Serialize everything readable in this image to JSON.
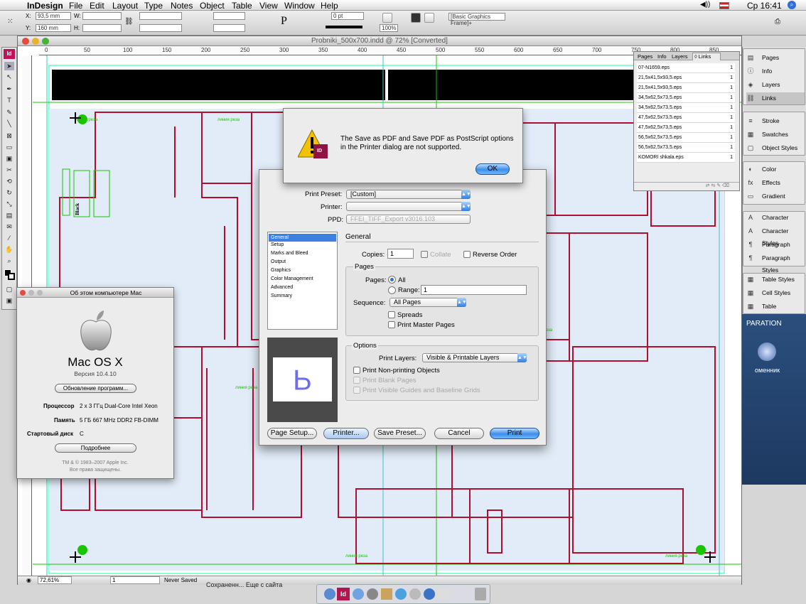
{
  "menubar": {
    "app": "InDesign",
    "items": [
      "File",
      "Edit",
      "Layout",
      "Type",
      "Notes",
      "Object",
      "Table",
      "View",
      "Window",
      "Help"
    ],
    "clock": "Ср 16:41"
  },
  "control_bar": {
    "x_label": "X:",
    "x_value": "93,5 mm",
    "y_label": "Y:",
    "y_value": "160 mm",
    "w_label": "W:",
    "h_label": "H:",
    "stroke_value": "0 pt",
    "zoom_value": "100%",
    "frame_style": "[Basic Graphics Frame]+"
  },
  "document": {
    "title": "Probniki_500x700.indd @ 72% [Converted]",
    "ruler_ticks": [
      "0",
      "50",
      "100",
      "150",
      "200",
      "250",
      "300",
      "350",
      "400",
      "450",
      "500",
      "550",
      "600",
      "650",
      "700",
      "750",
      "800",
      "850"
    ],
    "status_zoom": "72,61%",
    "status_page": "1",
    "status_save": "Never Saved",
    "slug_label": "линия реза"
  },
  "alert": {
    "message": "The Save as PDF and Save PDF as PostScript options in the Printer dialog are not supported.",
    "ok_label": "OK",
    "app_badge": "ID"
  },
  "print_dialog": {
    "preset_label": "Print Preset:",
    "preset_value": "[Custom]",
    "printer_label": "Printer:",
    "printer_value": "",
    "ppd_label": "PPD:",
    "ppd_value": "FFEI_TIFF_Export v3016.103",
    "categories": [
      "General",
      "Setup",
      "Marks and Bleed",
      "Output",
      "Graphics",
      "Color Management",
      "Advanced",
      "Summary"
    ],
    "section_title": "General",
    "copies_label": "Copies:",
    "copies_value": "1",
    "collate_label": "Collate",
    "reverse_label": "Reverse Order",
    "pages_group": "Pages",
    "pages_label": "Pages:",
    "all_label": "All",
    "range_label": "Range:",
    "range_value": "1",
    "sequence_label": "Sequence:",
    "sequence_value": "All Pages",
    "spreads_label": "Spreads",
    "master_label": "Print Master Pages",
    "options_group": "Options",
    "layers_label": "Print Layers:",
    "layers_value": "Visible & Printable Layers",
    "nonprint_label": "Print Non-printing Objects",
    "blank_label": "Print Blank Pages",
    "guides_label": "Print Visible Guides and Baseline Grids",
    "preview_glyph": "P",
    "buttons": {
      "page_setup": "Page Setup...",
      "printer": "Printer...",
      "save_preset": "Save Preset...",
      "cancel": "Cancel",
      "print": "Print"
    }
  },
  "about": {
    "title": "Об этом компьютере Mac",
    "os": "Mac OS X",
    "version": "Версия 10.4.10",
    "update_button": "Обновление программ...",
    "processor_label": "Процессор",
    "processor_value": "2 x 3 ГГц Dual-Core Intel Xeon",
    "memory_label": "Память",
    "memory_value": "5 ГБ 667 MHz DDR2 FB-DIMM",
    "disk_label": "Стартовый диск",
    "disk_value": "C",
    "more_button": "Подробнее",
    "copyright1": "TM & © 1983–2007 Apple Inc.",
    "copyright2": "Все права защищены."
  },
  "links_panel": {
    "tabs": [
      "Pages",
      "Info",
      "Layers",
      "◊ Links"
    ],
    "rows": [
      {
        "name": "07-N1659.eps",
        "page": "1"
      },
      {
        "name": "21,5x41,5x93,5.eps",
        "page": "1"
      },
      {
        "name": "21,5x41,5x93,5.eps",
        "page": "1"
      },
      {
        "name": "34,5x62,5x73,5.eps",
        "page": "1"
      },
      {
        "name": "34,5x62,5x73,5.eps",
        "page": "1"
      },
      {
        "name": "47,5x62,5x73,5.eps",
        "page": "1"
      },
      {
        "name": "47,5x62,5x73,5.eps",
        "page": "1"
      },
      {
        "name": "56,5x62,5x73,5.eps",
        "page": "1"
      },
      {
        "name": "56,5x62,5x73,5.eps",
        "page": "1"
      },
      {
        "name": "KOMORI shkala.eps",
        "page": "1"
      }
    ]
  },
  "right_dock": {
    "group1": [
      "Pages",
      "Info",
      "Layers",
      "Links"
    ],
    "group2": [
      "Stroke",
      "Swatches",
      "Object Styles"
    ],
    "group3": [
      "Color",
      "Effects",
      "Gradient"
    ],
    "group4": [
      "Character",
      "Character Styles",
      "Paragraph",
      "Paragraph Styles"
    ],
    "group5": [
      "Table Styles",
      "Cell Styles",
      "Table"
    ]
  },
  "desktop": {
    "label1": "PARATION",
    "label2": "оменник"
  },
  "taskbar_hint": "Сохраненн... Еще с сайта",
  "colors": {
    "dieline": "#b0102f",
    "guide_green": "#19c400",
    "panel_fill": "#e2ecf8",
    "aqua_blue": "#3d8ee8"
  }
}
